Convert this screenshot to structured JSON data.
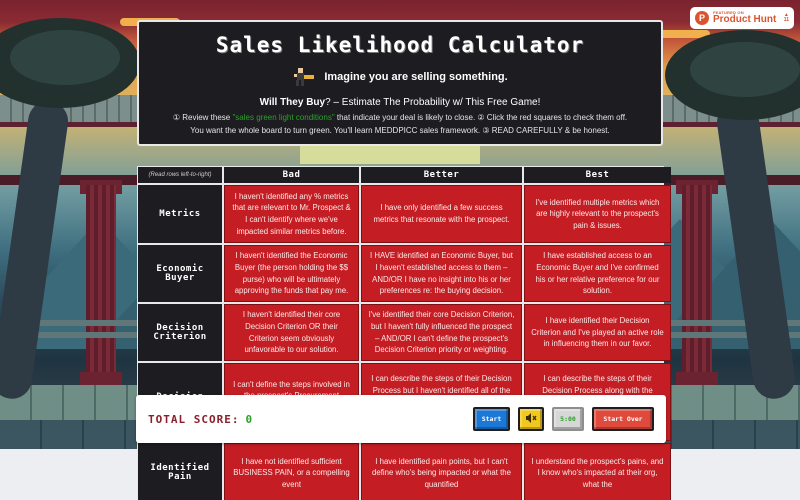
{
  "badge": {
    "featured_on": "FEATURED ON",
    "name": "Product Hunt",
    "logo_letter": "P",
    "vote_arrow": "▲",
    "vote_count": "11",
    "color": "#da552f"
  },
  "header": {
    "title": "Sales Likelihood Calculator",
    "tagline": "Imagine you are selling something.",
    "subtitle_bold": "Will They Buy",
    "subtitle_rest": "? – Estimate The Probability w/ This Free Game!",
    "instructions_1a": "① Review these ",
    "instructions_green": "\"sales green light conditions\"",
    "instructions_1b": " that indicate your deal is likely to close. ② Click the red squares to check them off.",
    "instructions_2": "You want the whole board to turn green. You'll learn MEDDPICC sales framework. ③ READ CAREFULLY & be honest."
  },
  "board": {
    "note": "(Read rows left-to-right)",
    "columns": [
      "Bad",
      "Better",
      "Best"
    ],
    "rows": [
      {
        "label": "Metrics",
        "cells": [
          "I haven't identified any % metrics that are relevant to Mr. Prospect & I can't identify where we've impacted similar metrics before.",
          "I have only identified a few success metrics that resonate with the prospect.",
          "I've identified multiple metrics which are highly relevant to the prospect's pain & issues."
        ]
      },
      {
        "label": "Economic Buyer",
        "cells": [
          "I haven't identified the Economic Buyer (the person holding the $$ purse) who will be ultimately approving the funds that pay me.",
          "I HAVE identified an Economic Buyer, but I haven't established access to them – AND/OR I have no insight into his or her preferences re: the buying decision.",
          "I have established access to an Economic Buyer and I've confirmed his or her relative preference for our solution."
        ]
      },
      {
        "label": "Decision Criterion",
        "cells": [
          "I haven't identified their core Decision Criterion OR their Criterion seem obviously unfavorable to our solution.",
          "I've identified their core Decision Criterion, but I haven't fully influenced the prospect – AND/OR I can't define the prospect's Decision Criterion priority or weighting.",
          "I have identified their Decision Criterion and I've played an active role in influencing them in our favor."
        ]
      },
      {
        "label": "Decision Process",
        "cells": [
          "I can't define the steps involved in the prospect's Procurement Process (Paperwork, Legal Review, Signatures)",
          "I can describe the steps of their Decision Process but I haven't identified all of the players in the Procurement Process, but I haven't identified the majority of the players AND/OR timelines.",
          "I can describe the steps of their Decision Process along with the resources & Procurement Process along with the people & timelines for each step."
        ]
      },
      {
        "label": "Identified Pain",
        "cells": [
          "I have not identified sufficient BUSINESS PAIN, or a compelling event",
          "I have identified pain points, but I can't define who's being impacted or what the quantified",
          "I understand the prospect's pains, and I know who's impacted at their org, what the"
        ]
      }
    ],
    "cell_color": "#c41e24"
  },
  "scorebar": {
    "label": "TOTAL SCORE:",
    "score": "0",
    "start_label": "Start",
    "mute_icon": "🔇",
    "timer": "5:00",
    "reset_label": "Start Over"
  }
}
